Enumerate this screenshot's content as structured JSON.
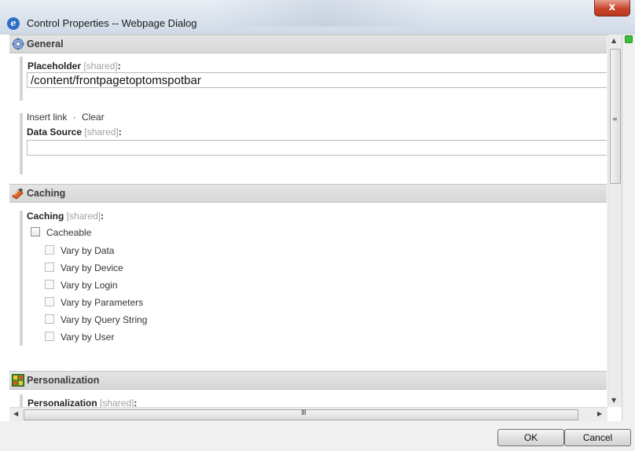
{
  "window": {
    "title": "Control Properties -- Webpage Dialog",
    "close_glyph": "x",
    "ie_glyph": "e"
  },
  "sections": {
    "general": {
      "title": "General",
      "placeholder": {
        "label": "Placeholder",
        "shared": "[shared]",
        "colon": ":",
        "value": "/content/frontpagetoptomspotbar"
      },
      "links": {
        "insert": "Insert link",
        "separator": "·",
        "clear": "Clear"
      },
      "datasource": {
        "label": "Data Source",
        "shared": "[shared]",
        "colon": ":",
        "value": ""
      }
    },
    "caching": {
      "title": "Caching",
      "label": "Caching",
      "shared": "[shared]",
      "colon": ":",
      "cacheable": "Cacheable",
      "options": [
        "Vary by Data",
        "Vary by Device",
        "Vary by Login",
        "Vary by Parameters",
        "Vary by Query String",
        "Vary by User"
      ]
    },
    "personalization": {
      "title": "Personalization",
      "label": "Personalization",
      "shared": "[shared]",
      "colon": ":"
    }
  },
  "scrollbar": {
    "grip_v": "≡",
    "grip_h": "III"
  },
  "footer": {
    "ok": "OK",
    "cancel": "Cancel"
  },
  "colors": {
    "title_bg": "#dde5ef",
    "section_bg": "#dcdcdc",
    "close": "#c8452b",
    "status": "#3cbf3c"
  },
  "icons": {
    "general": "gear-icon",
    "caching": "caching-icon",
    "personalization": "personalization-icon"
  }
}
